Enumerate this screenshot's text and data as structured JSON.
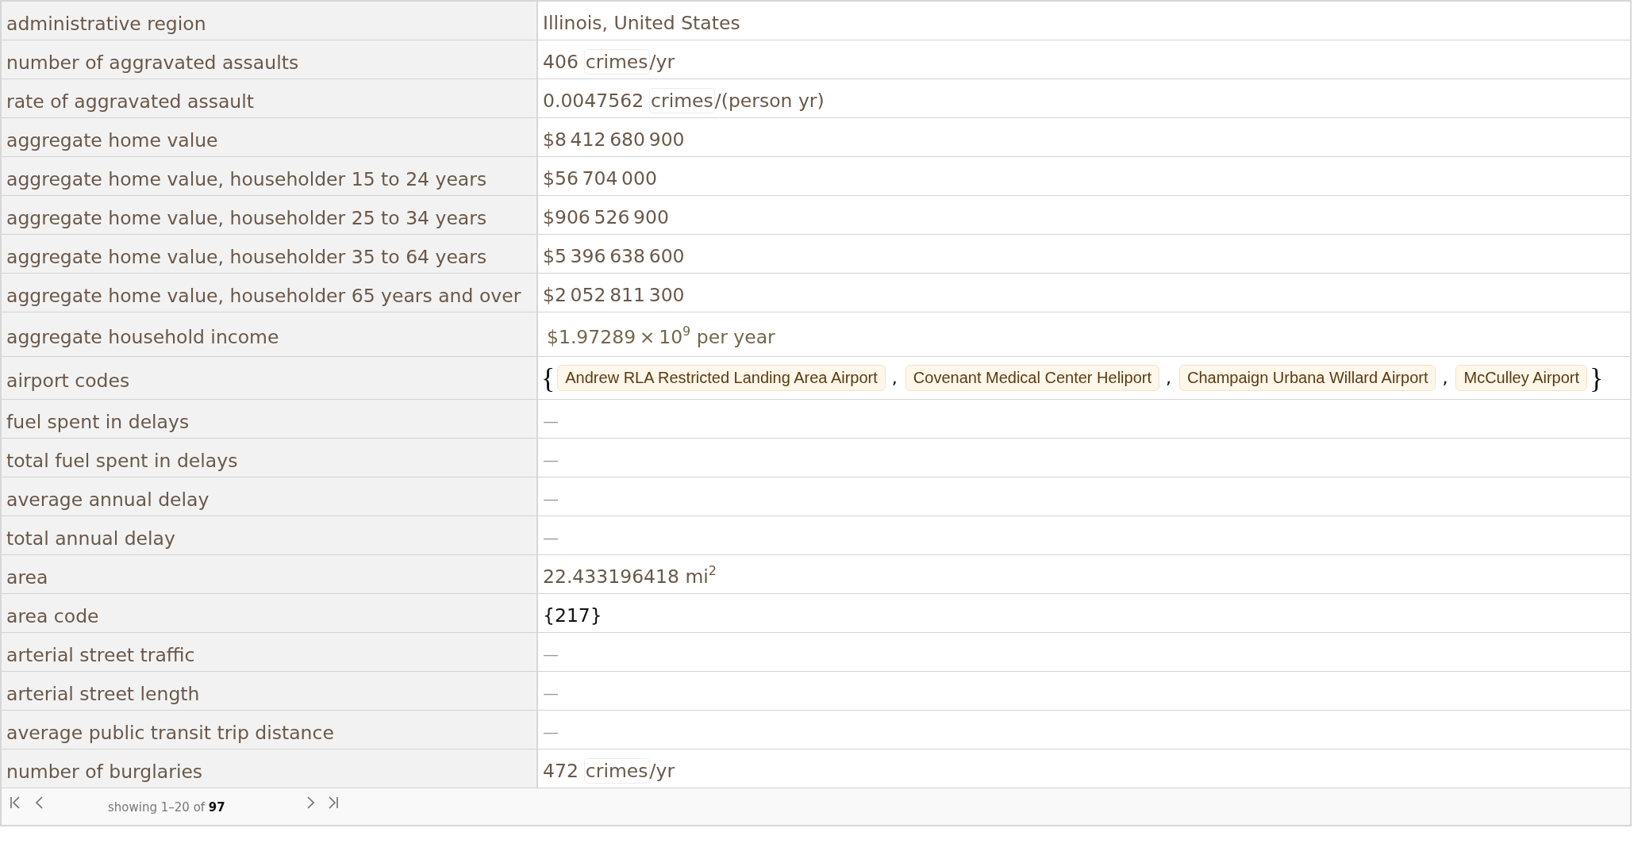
{
  "table": {
    "rows": [
      {
        "label": "administrative region",
        "value": {
          "kind": "text",
          "text": "Illinois, United States"
        }
      },
      {
        "label": "number of aggravated assaults",
        "value": {
          "kind": "quantity",
          "magnitude": "406",
          "unit": "crimes",
          "unit_rest": "/yr"
        }
      },
      {
        "label": "rate of aggravated assault",
        "value": {
          "kind": "quantity",
          "magnitude": "0.0047562",
          "unit": "crimes",
          "unit_rest": "/(person yr)"
        }
      },
      {
        "label": "aggregate home value",
        "value": {
          "kind": "text",
          "text": "$8 412 680 900"
        }
      },
      {
        "label": "aggregate home value, householder 15 to 24 years",
        "value": {
          "kind": "text",
          "text": "$56 704 000"
        }
      },
      {
        "label": "aggregate home value, householder 25 to 34 years",
        "value": {
          "kind": "text",
          "text": "$906 526 900"
        }
      },
      {
        "label": "aggregate home value, householder 35 to 64 years",
        "value": {
          "kind": "text",
          "text": "$5 396 638 600"
        }
      },
      {
        "label": "aggregate home value, householder 65 years and over",
        "value": {
          "kind": "text",
          "text": "$2 052 811 300"
        }
      },
      {
        "label": "aggregate household income",
        "value": {
          "kind": "scientific",
          "text": "$1.97289 × 10$^{9}$ per year"
        }
      },
      {
        "label": "airport codes",
        "value": {
          "kind": "entity_list",
          "open": "{",
          "close": "}",
          "items": [
            {
              "label": "Andrew RLA Restricted Landing Area Airport",
              "separator": ","
            },
            {
              "label": "Covenant Medical Center Heliport",
              "separator": ","
            },
            {
              "label": "Champaign Urbana Willard Airport",
              "separator": ","
            },
            {
              "label": "McCulley Airport"
            }
          ]
        }
      },
      {
        "label": "fuel spent in delays",
        "value": {
          "kind": "missing",
          "text": "—"
        }
      },
      {
        "label": "total fuel spent in delays",
        "value": {
          "kind": "missing",
          "text": "—"
        }
      },
      {
        "label": "average annual delay",
        "value": {
          "kind": "missing",
          "text": "—"
        }
      },
      {
        "label": "total annual delay",
        "value": {
          "kind": "missing",
          "text": "—"
        }
      },
      {
        "label": "area",
        "value": {
          "kind": "text",
          "text": "22.433196418 mi$^{2}$"
        }
      },
      {
        "label": "area code",
        "value": {
          "kind": "raw",
          "text": "{217}"
        }
      },
      {
        "label": "arterial street traffic",
        "value": {
          "kind": "missing",
          "text": "—"
        }
      },
      {
        "label": "arterial street length",
        "value": {
          "kind": "missing",
          "text": "—"
        }
      },
      {
        "label": "average public transit trip distance",
        "value": {
          "kind": "missing",
          "text": "—"
        }
      },
      {
        "label": "number of burglaries",
        "value": {
          "kind": "quantity",
          "magnitude": "472",
          "unit": "crimes",
          "unit_rest": "/yr"
        }
      }
    ]
  },
  "pagination": {
    "status": "showing 1–20 of **97**"
  }
}
